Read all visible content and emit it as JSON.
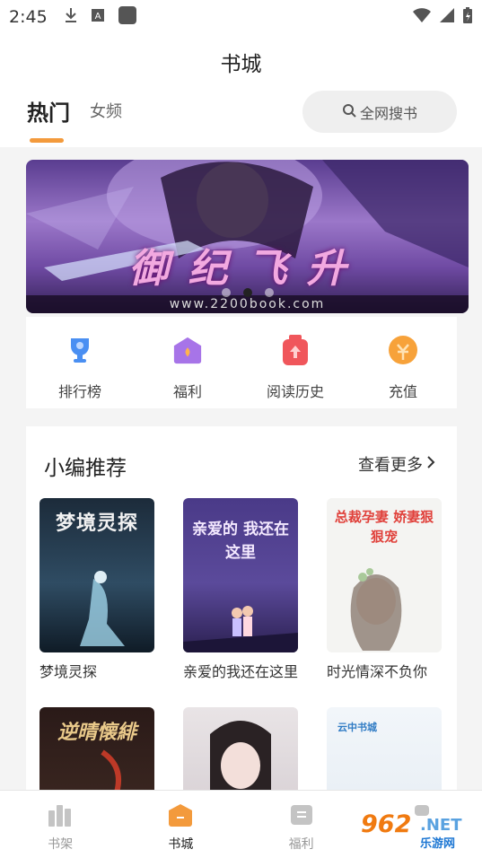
{
  "status_bar": {
    "time": "2:45",
    "icons": [
      "download-icon",
      "keyboard-a-icon",
      "app-square-icon",
      "wifi-icon",
      "signal-icon",
      "battery-icon"
    ]
  },
  "header": {
    "title": "书城",
    "tabs": [
      {
        "label": "热门",
        "active": true
      },
      {
        "label": "女频",
        "active": false
      }
    ],
    "search_label": "全网搜书"
  },
  "banner": {
    "title": "御纪飞升",
    "url_text": "www.2200book.com",
    "slide_count": 3,
    "active_slide": 2
  },
  "quick_links": [
    {
      "label": "排行榜",
      "icon": "trophy-icon",
      "color": "#4a8ff2"
    },
    {
      "label": "福利",
      "icon": "gift-house-icon",
      "color": "#a774e8"
    },
    {
      "label": "阅读历史",
      "icon": "history-bag-icon",
      "color": "#f0565b"
    },
    {
      "label": "充值",
      "icon": "coin-icon",
      "color": "#f7a23a"
    }
  ],
  "recommend": {
    "title": "小编推荐",
    "more_label": "查看更多",
    "books": [
      {
        "title": "梦境灵探",
        "cover_text": "梦境灵探"
      },
      {
        "title": "亲爱的我还在这里",
        "cover_text": "亲爱的 我还在这里"
      },
      {
        "title": "时光情深不负你",
        "cover_text": "总裁孕妻 娇妻狠狠宠"
      },
      {
        "title": "",
        "cover_text": "逆晴懐緋"
      },
      {
        "title": "",
        "cover_text": ""
      },
      {
        "title": "",
        "cover_text": "云中书城"
      }
    ]
  },
  "bottom_nav": [
    {
      "label": "书架",
      "icon": "bookshelf-icon",
      "active": false
    },
    {
      "label": "书城",
      "icon": "bookstore-icon",
      "active": true
    },
    {
      "label": "福利",
      "icon": "benefit-icon",
      "active": false
    },
    {
      "label": "",
      "icon": "profile-icon",
      "active": false
    }
  ],
  "watermark": {
    "number": "962",
    "net": ".NET",
    "site": "乐游网"
  },
  "colors": {
    "accent": "#f39a3c",
    "banner_text": "#f2a9e0"
  }
}
